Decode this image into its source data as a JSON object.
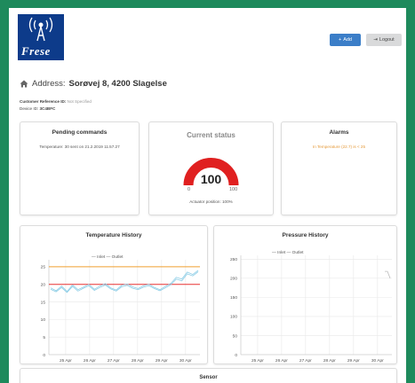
{
  "header": {
    "logo_text": "Frese",
    "add_label": "Add",
    "add_icon": "plus-icon",
    "logout_label": "Logout",
    "logout_icon": "signout-icon"
  },
  "address": {
    "icon": "home-icon",
    "label": "Address:",
    "value": "Sorøvej 8, 4200 Slagelse"
  },
  "meta": {
    "customer_ref_label": "Customer Reference ID:",
    "customer_ref_value": "Not Specified",
    "device_label": "Device ID:",
    "device_value": "3C4BFC"
  },
  "pending": {
    "title": "Pending commands",
    "text": "Temperature: 30 sent on 21.2.2019 11.57.27"
  },
  "status": {
    "title": "Current status",
    "value": "100",
    "min": "0",
    "max": "100",
    "actuator": "Actuator position: 100%",
    "gauge_fraction": 1.0,
    "gauge_color": "#e02020"
  },
  "alarms": {
    "title": "Alarms",
    "text": "In Temperature (22.7) is < 25",
    "color": "#e59a3a"
  },
  "chart_data": [
    {
      "type": "line",
      "title": "Temperature History",
      "legend": [
        "Inlet",
        "Outlet"
      ],
      "x_labels": [
        "25 Apr",
        "26 Apr",
        "27 Apr",
        "28 Apr",
        "29 Apr",
        "30 Apr"
      ],
      "y_ticks": [
        0,
        5,
        10,
        15,
        20,
        25
      ],
      "ylim": [
        0,
        27
      ],
      "series": [
        {
          "name": "Inlet",
          "color": "#8ccde6",
          "values": [
            19,
            18.2,
            19.5,
            18,
            19.8,
            18.5,
            19.2,
            20,
            18.6,
            19.5,
            20.2,
            19,
            18.4,
            19.7,
            20.1,
            19.3,
            18.8,
            19.6,
            20,
            19.1,
            18.5,
            19.4,
            20.3,
            22,
            21.5,
            23.5,
            22.8,
            24
          ]
        },
        {
          "name": "Outlet",
          "color": "#8ccde6",
          "values": [
            18.6,
            17.9,
            19.1,
            17.7,
            19.4,
            18.1,
            18.9,
            19.6,
            18.3,
            19.1,
            19.8,
            18.7,
            18.1,
            19.3,
            19.7,
            18.9,
            18.5,
            19.2,
            19.6,
            18.8,
            18.2,
            19,
            19.9,
            21.5,
            21,
            23,
            22.4,
            23.6
          ]
        }
      ],
      "threshold_lines": [
        {
          "value": 25,
          "color": "#f0a030"
        },
        {
          "value": 20,
          "color": "#e83030"
        }
      ]
    },
    {
      "type": "line",
      "title": "Pressure History",
      "legend": [
        "Inlet",
        "Outlet"
      ],
      "x_labels": [
        "25 Apr",
        "26 Apr",
        "27 Apr",
        "28 Apr",
        "29 Apr",
        "30 Apr"
      ],
      "y_ticks": [
        0,
        50,
        100,
        150,
        200,
        250
      ],
      "ylim": [
        0,
        260
      ],
      "series": [
        {
          "name": "Inlet",
          "color": "#bbbbbb",
          "values": [
            218,
            218,
            200
          ]
        }
      ]
    }
  ],
  "sensor": {
    "title": "Sensor"
  }
}
